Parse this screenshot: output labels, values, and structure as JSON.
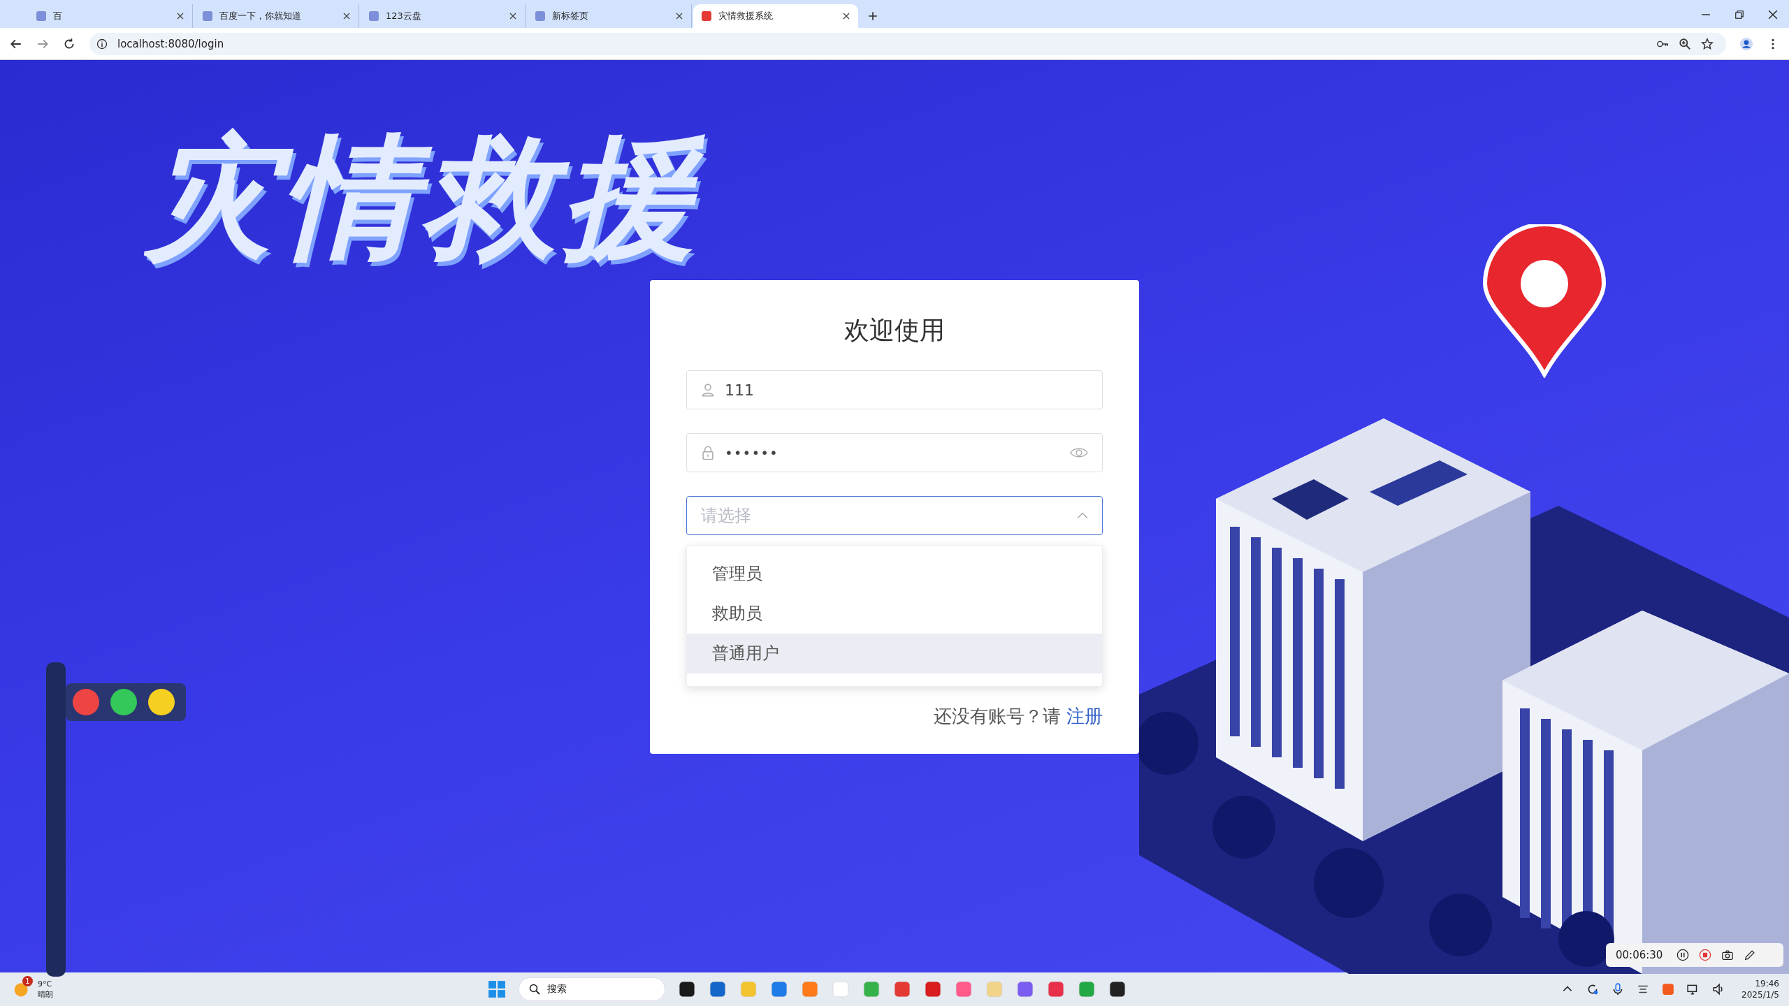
{
  "browser": {
    "tabs": [
      {
        "title": "百",
        "selected": false
      },
      {
        "title": "百度一下，你就知道",
        "selected": false
      },
      {
        "title": "123云盘",
        "selected": false
      },
      {
        "title": "新标签页",
        "selected": false
      },
      {
        "title": "灾情救援系统",
        "selected": true
      }
    ],
    "address": "localhost:8080/login"
  },
  "page": {
    "hero_title": "灾情救援",
    "login": {
      "title": "欢迎使用",
      "username": {
        "value": "111"
      },
      "password": {
        "value": "••••••"
      },
      "role_select": {
        "placeholder": "请选择",
        "open": true,
        "options": [
          {
            "label": "管理员",
            "selected": false,
            "hovered": false
          },
          {
            "label": "救助员",
            "selected": false,
            "hovered": false
          },
          {
            "label": "普通用户",
            "selected": false,
            "hovered": true
          }
        ]
      },
      "footer": {
        "prompt": "还没有账号？请",
        "link": "注册"
      }
    }
  },
  "recorder": {
    "time": "00:06:30"
  },
  "taskbar": {
    "weather": {
      "badge": "1",
      "temperature": "9°C",
      "condition": "晴朗"
    },
    "search": {
      "placeholder": "搜索"
    },
    "clock": {
      "time": "19:46",
      "date": "2025/1/5"
    }
  }
}
